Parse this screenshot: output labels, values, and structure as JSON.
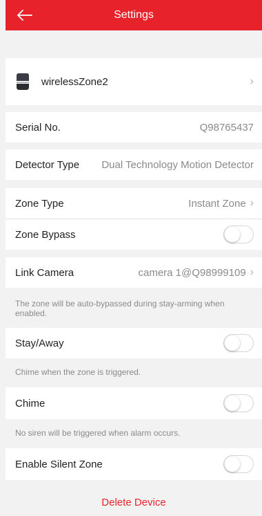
{
  "header": {
    "title": "Settings"
  },
  "device": {
    "name": "wirelessZone2"
  },
  "serial": {
    "label": "Serial No.",
    "value": "Q98765437"
  },
  "detector": {
    "label": "Detector Type",
    "value": "Dual Technology Motion Detector"
  },
  "zone_type": {
    "label": "Zone Type",
    "value": "Instant Zone"
  },
  "zone_bypass": {
    "label": "Zone Bypass",
    "enabled": false
  },
  "link_camera": {
    "label": "Link Camera",
    "value": "camera 1@Q98999109"
  },
  "stay_away": {
    "hint": "The zone will be auto-bypassed during stay-arming when enabled.",
    "label": "Stay/Away",
    "enabled": false
  },
  "chime": {
    "hint": "Chime when the zone is triggered.",
    "label": "Chime",
    "enabled": false
  },
  "silent": {
    "hint": "No siren will be triggered when alarm occurs.",
    "label": "Enable Silent Zone",
    "enabled": false
  },
  "actions": {
    "delete_label": "Delete Device"
  },
  "colors": {
    "accent": "#e8222b",
    "background": "#f2f2f2"
  }
}
